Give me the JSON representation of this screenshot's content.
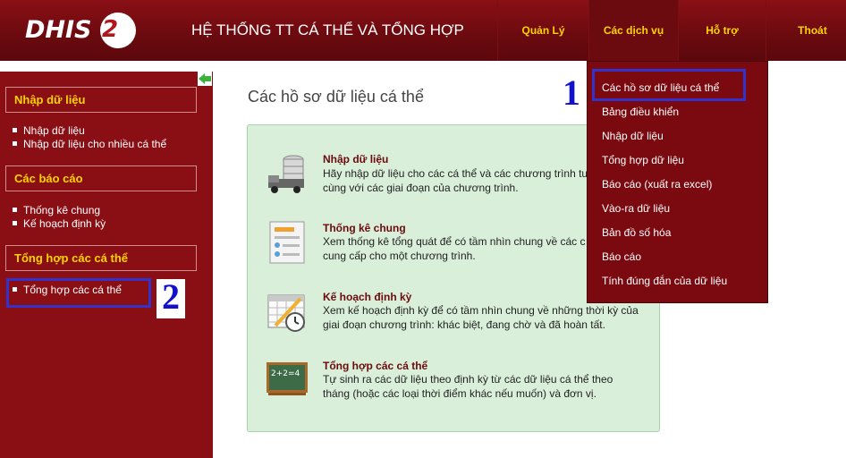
{
  "header": {
    "logo_main": "DHIS",
    "logo_num": "2",
    "title": "HỆ THỐNG TT CÁ THỂ VÀ TỔNG HỢP",
    "nav": [
      "Quản Lý",
      "Các dịch vụ",
      "Hỗ trợ",
      "Thoát"
    ]
  },
  "dropdown": {
    "items": [
      "Các hồ sơ dữ liệu cá thể",
      "Bảng điều khiển",
      "Nhập dữ liệu",
      "Tổng hợp dữ liệu",
      "Báo cáo (xuất ra excel)",
      "Vào-ra dữ liệu",
      "Bản đồ số hóa",
      "Báo cáo",
      "Tính đúng đắn của dữ liệu"
    ]
  },
  "annotations": {
    "one": "1",
    "two": "2"
  },
  "sidebar": {
    "sections": [
      {
        "title": "Nhập dữ liệu",
        "links": [
          "Nhập dữ liệu",
          "Nhập dữ liệu cho nhiều cá thể"
        ]
      },
      {
        "title": "Các báo cáo",
        "links": [
          "Thống kê chung",
          "Kế hoạch định kỳ"
        ]
      },
      {
        "title": "Tổng hợp các cá thể",
        "links": [
          "Tổng hợp các cá thể"
        ]
      }
    ]
  },
  "main": {
    "title": "Các hồ sơ dữ liệu cá thể",
    "features": [
      {
        "title": "Nhập dữ liệu",
        "desc1": "Hãy nhập dữ liệu cho các cá thể và các chương trình tư",
        "desc2": "cùng với các giai đoạn của chương trình."
      },
      {
        "title": "Thống kê chung",
        "desc1": "Xem thống kê tổng quát để có tầm nhìn chung về các c",
        "desc2": "cung cấp cho một chương trình."
      },
      {
        "title": "Kế hoạch định kỳ",
        "desc1": "Xem kế hoạch định kỳ để có tầm nhìn chung về những thời kỳ của",
        "desc2": "giai đoạn chương trình: khác biệt, đang chờ và đã hoàn tất."
      },
      {
        "title": "Tổng hợp các cá thể",
        "desc1": "Tự sinh ra các dữ liệu theo định kỳ từ các dữ liệu cá thể theo",
        "desc2": "tháng (hoặc các loại thời điểm khác nếu muốn) và đơn vị."
      }
    ],
    "chalkboard_text": "2+2=4"
  }
}
